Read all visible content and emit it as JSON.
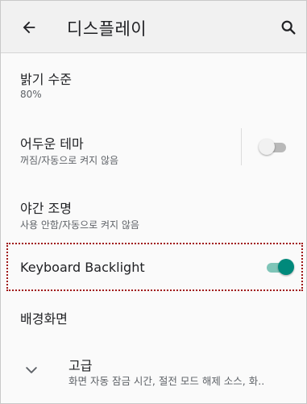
{
  "header": {
    "title": "디스플레이",
    "back_icon": "arrow-back-icon",
    "search_icon": "search-icon"
  },
  "settings": [
    {
      "title": "밝기 수준",
      "summary": "80%"
    },
    {
      "title": "어두운 테마",
      "summary": "꺼짐/자동으로 켜지 않음",
      "toggle": "off"
    },
    {
      "title": "야간 조명",
      "summary": "사용 안함/자동으로 켜지 않음"
    },
    {
      "title": "Keyboard Backlight",
      "toggle": "on"
    },
    {
      "title": "배경화면"
    },
    {
      "title": "고급",
      "summary": "화면 자동 잠금 시간, 절전 모드 해제 소스, 화..",
      "icon": "chevron-down-icon"
    }
  ],
  "colors": {
    "accent": "#00897b",
    "accent_track": "#7fc5b8",
    "highlight_border": "#a01818"
  }
}
